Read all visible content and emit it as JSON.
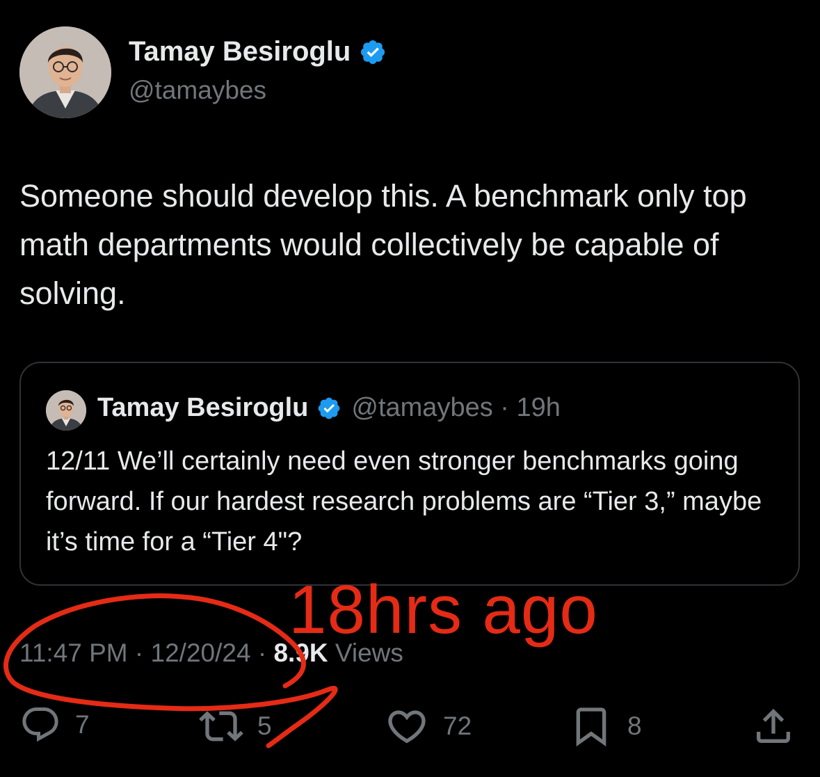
{
  "tweet": {
    "author": {
      "display_name": "Tamay Besiroglu",
      "handle": "@tamaybes",
      "verified": true
    },
    "text": "Someone should develop this. A benchmark only top math departments would collectively be capable of solving."
  },
  "quote": {
    "display_name": "Tamay Besiroglu",
    "handle": "@tamaybes",
    "separator": " · ",
    "age": "19h",
    "text": "12/11 We’ll certainly need even stronger benchmarks going forward. If our hardest research problems are “Tier 3,” maybe it’s time for a “Tier 4\"?"
  },
  "meta": {
    "time": "11:47 PM",
    "sep1": " · ",
    "date": "12/20/24",
    "sep2": " · ",
    "views_count": "8.9K",
    "views_label": " Views"
  },
  "actions": {
    "replies": "7",
    "reposts": "5",
    "likes": "72",
    "bookmarks": "8"
  },
  "annotation": {
    "text": "18hrs ago"
  },
  "colors": {
    "background": "#000000",
    "primary_text": "#e7e9ea",
    "secondary_text": "#71767b",
    "verified_badge": "#1d9bf0",
    "annotation_red": "#e52b16",
    "card_border": "#2f3336"
  },
  "icons": [
    "verified-badge-icon",
    "reply-icon",
    "repost-icon",
    "like-icon",
    "bookmark-icon",
    "share-icon"
  ]
}
